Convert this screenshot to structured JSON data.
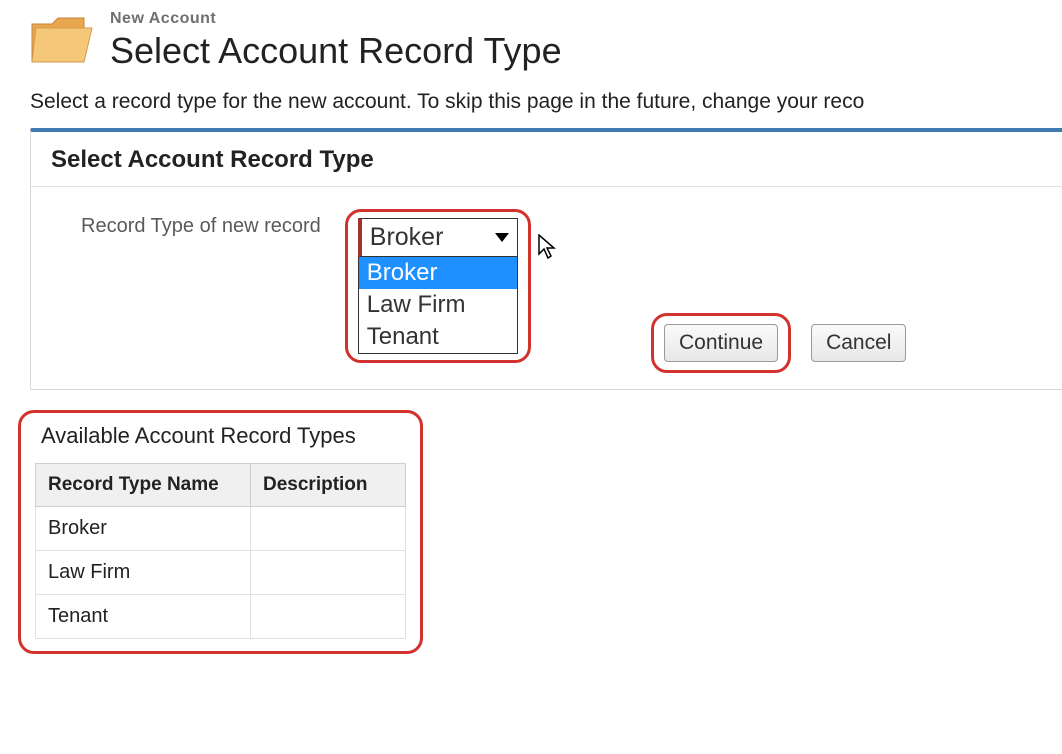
{
  "header": {
    "breadcrumb": "New Account",
    "title": "Select Account Record Type"
  },
  "intro": "Select a record type for the new account. To skip this page in the future, change your reco",
  "panel": {
    "heading": "Select Account Record Type",
    "field_label": "Record Type of new record",
    "selected": "Broker",
    "options": [
      "Broker",
      "Law Firm",
      "Tenant"
    ],
    "highlighted_option": "Broker"
  },
  "buttons": {
    "continue": "Continue",
    "cancel": "Cancel"
  },
  "available": {
    "heading": "Available Account Record Types",
    "columns": [
      "Record Type Name",
      "Description"
    ],
    "rows": [
      {
        "name": "Broker",
        "desc": ""
      },
      {
        "name": "Law Firm",
        "desc": ""
      },
      {
        "name": "Tenant",
        "desc": ""
      }
    ]
  }
}
